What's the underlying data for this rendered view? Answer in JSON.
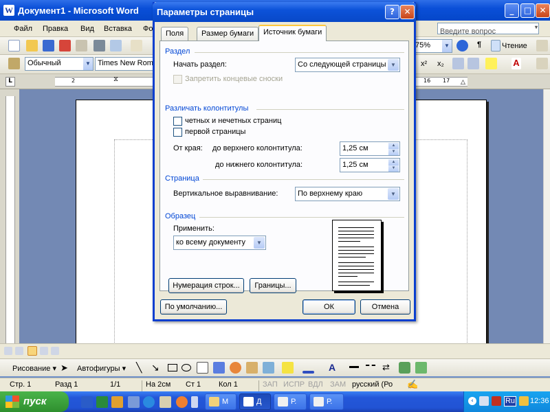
{
  "word_window": {
    "title": "Документ1 - Microsoft Word",
    "app_icon": "W",
    "min_label": "_",
    "max_label": "□",
    "close_label": "✕"
  },
  "menu": {
    "items": [
      "Файл",
      "Правка",
      "Вид",
      "Вставка",
      "Фо"
    ],
    "help_placeholder": "Введите вопрос",
    "help_arrow": "▾"
  },
  "toolbar": {
    "zoom": "75%",
    "reading": "Чтение",
    "style": "Обычный",
    "font": "Times New Roma",
    "para_mark": "¶",
    "superscript": "x²",
    "subscript": "x₂"
  },
  "ruler": {
    "left_num": "2",
    "right_nums": [
      "16",
      "17"
    ]
  },
  "dialog": {
    "title": "Параметры страницы",
    "help_label": "?",
    "close_label": "✕",
    "tabs": [
      "Поля",
      "Размер бумаги",
      "Источник бумаги"
    ],
    "active_tab": 2,
    "section": {
      "heading": "Раздел",
      "start_label": "Начать раздел:",
      "start_value": "Со следующей страницы",
      "suppress_endnotes": "Запретить концевые сноски",
      "suppress_endnotes_checked": false
    },
    "headers": {
      "heading": "Различать колонтитулы",
      "odd_even": "четных и нечетных страниц",
      "odd_even_checked": false,
      "first_page": "первой страницы",
      "first_page_checked": false,
      "from_edge": "От края:",
      "header_label": "до верхнего колонтитула:",
      "header_value": "1,25 см",
      "footer_label": "до нижнего колонтитула:",
      "footer_value": "1,25 см"
    },
    "page": {
      "heading": "Страница",
      "valign_label": "Вертикальное выравнивание:",
      "valign_value": "По верхнему краю"
    },
    "preview": {
      "heading": "Образец",
      "apply_label": "Применить:",
      "apply_value": "ко всему документу"
    },
    "line_numbers_button": "Нумерация строк...",
    "borders_button": "Границы...",
    "default_button": "По умолчанию...",
    "ok_button": "ОК",
    "cancel_button": "Отмена"
  },
  "drawbar": {
    "draw": "Рисование ▾",
    "autoshapes": "Автофигуры ▾"
  },
  "status": {
    "page": "Стр. 1",
    "section": "Разд 1",
    "pages": "1/1",
    "at": "На 2см",
    "line": "Ст 1",
    "col": "Кол 1",
    "rec": "ЗАП",
    "trk": "ИСПР",
    "ext": "ВДЛ",
    "ovr": "ЗАМ",
    "lang": "русский (Ро"
  },
  "taskbar": {
    "start": "пуск",
    "buttons": [
      "М",
      "Д",
      "Р.",
      "Р."
    ],
    "lang": "Ru",
    "clock": "12:36"
  },
  "colors": {
    "xp_blue": "#0a4fd8",
    "dialog_face": "#ece9d8",
    "group_heading": "#0046d5",
    "start_green": "#3a9b3a"
  }
}
